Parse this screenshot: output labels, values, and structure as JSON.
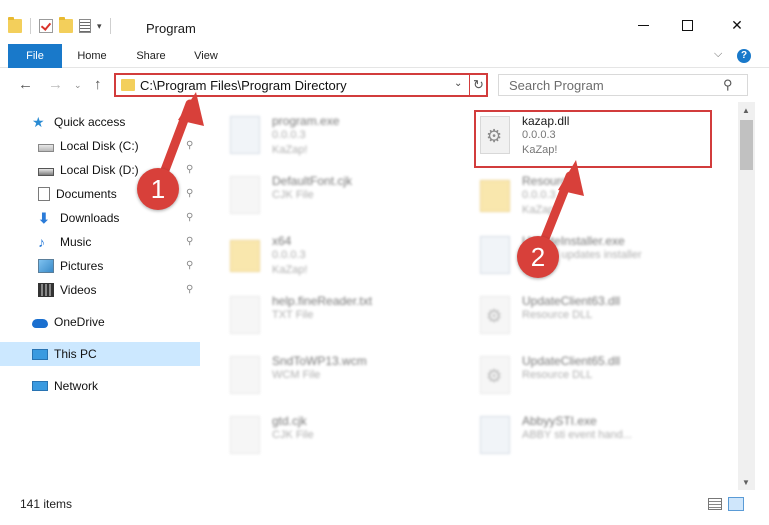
{
  "window": {
    "title": "Program",
    "minimize_icon": "minimize-icon",
    "maximize_icon": "maximize-icon",
    "close_glyph": "✕"
  },
  "ribbon": {
    "tabs": [
      "File",
      "Home",
      "Share",
      "View"
    ],
    "help_glyph": "?",
    "expand_glyph": "⌵"
  },
  "nav": {
    "back": "←",
    "forward": "→",
    "recent": "⌄",
    "up": "↑",
    "address": "C:\\Program Files\\Program Directory",
    "address_dropdown": "⌄",
    "refresh": "↻",
    "search_placeholder": "Search Program",
    "search_icon": "⚲"
  },
  "sidebar": {
    "items": [
      {
        "label": "Quick access",
        "icon": "star-icon"
      },
      {
        "label": "Local Disk (C:)",
        "icon": "drive-icon",
        "pinned": true
      },
      {
        "label": "Local Disk (D:)",
        "icon": "drive-icon",
        "pinned": true
      },
      {
        "label": "Documents",
        "icon": "documents-icon",
        "pinned": true
      },
      {
        "label": "Downloads",
        "icon": "downloads-icon",
        "pinned": true
      },
      {
        "label": "Music",
        "icon": "music-icon",
        "pinned": true
      },
      {
        "label": "Pictures",
        "icon": "pictures-icon",
        "pinned": true
      },
      {
        "label": "Videos",
        "icon": "videos-icon",
        "pinned": true
      },
      {
        "label": "OneDrive",
        "icon": "onedrive-icon"
      },
      {
        "label": "This PC",
        "icon": "this-pc-icon",
        "selected": true
      },
      {
        "label": "Network",
        "icon": "network-icon"
      }
    ],
    "pin_glyph": "📌"
  },
  "files": [
    {
      "name": "program.exe",
      "line1": "0.0.0.3",
      "line2": "KaZap!",
      "icon": "exe-icon"
    },
    {
      "name": "kazap.dll",
      "line1": "0.0.0.3",
      "line2": "KaZap!",
      "icon": "dll-icon",
      "highlighted": true
    },
    {
      "name": "DefaultFont.cjk",
      "line1": "CJK File",
      "line2": "",
      "icon": "file-icon"
    },
    {
      "name": "Resource",
      "line1": "0.0.0.3",
      "line2": "KaZap!",
      "icon": "folder-icon"
    },
    {
      "name": "x64",
      "line1": "0.0.0.3",
      "line2": "KaZap!",
      "icon": "folder-icon"
    },
    {
      "name": "UpdateInstaller.exe",
      "line1": "ABBYY updates installer",
      "line2": "",
      "icon": "exe-icon"
    },
    {
      "name": "help.fineReader.txt",
      "line1": "TXT File",
      "line2": "",
      "icon": "file-icon"
    },
    {
      "name": "UpdateClient63.dll",
      "line1": "Resource DLL",
      "line2": "",
      "icon": "dll-icon"
    },
    {
      "name": "SndToWP13.wcm",
      "line1": "WCM File",
      "line2": "",
      "icon": "file-icon"
    },
    {
      "name": "UpdateClient65.dll",
      "line1": "Resource DLL",
      "line2": "",
      "icon": "dll-icon"
    },
    {
      "name": "gtd.cjk",
      "line1": "CJK File",
      "line2": "",
      "icon": "file-icon"
    },
    {
      "name": "AbbyySTI.exe",
      "line1": "ABBY sti event hand...",
      "line2": "",
      "icon": "exe-icon"
    }
  ],
  "status": {
    "item_count": "141 items"
  },
  "callouts": [
    "1",
    "2"
  ],
  "colors": {
    "accent": "#1979ca",
    "highlight_red": "#d23c3c",
    "selected_bg": "#cce8ff"
  }
}
